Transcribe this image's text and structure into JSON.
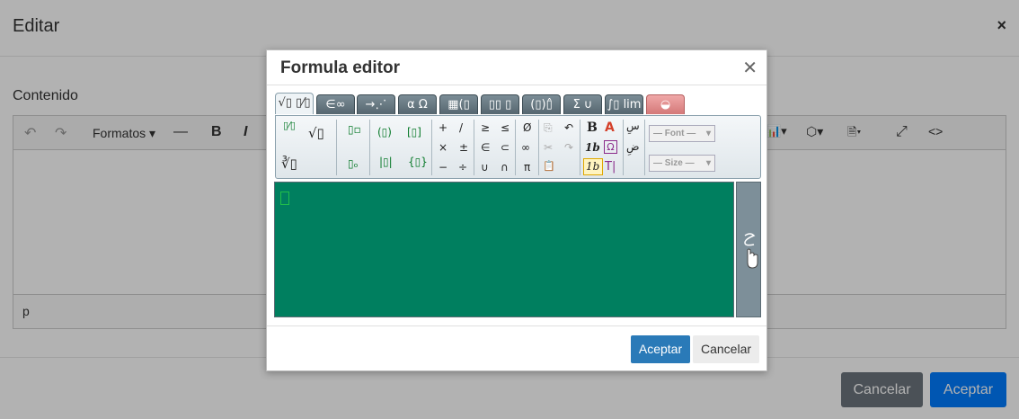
{
  "background": {
    "title": "Editar",
    "close_glyph": "×",
    "field_label": "Contenido",
    "toolbar": {
      "undo_glyph": "↶",
      "redo_glyph": "↷",
      "formats_label": "Formatos ▾",
      "hr_glyph": "—",
      "bold_glyph": "B",
      "italic_glyph": "I",
      "chart_glyph": "📊▾",
      "box_glyph": "⬡▾",
      "doc_glyph": "🗎▾",
      "fullscreen_glyph": "⤢",
      "code_glyph": "<>"
    },
    "status_path": "p",
    "cancel_label": "Cancelar",
    "accept_label": "Aceptar"
  },
  "modal": {
    "title": "Formula editor",
    "close_glyph": "✕",
    "tabs": [
      {
        "label": "√▯ ▯⁄▯",
        "icon": "fraction-root-tab"
      },
      {
        "label": "∈∞",
        "icon": "symbols-tab"
      },
      {
        "label": "→⋰",
        "icon": "arrows-tab"
      },
      {
        "label": "α Ω",
        "icon": "greek-tab"
      },
      {
        "label": "▦(▯",
        "icon": "matrix-tab"
      },
      {
        "label": "▯▯ ▯",
        "icon": "scripts-tab"
      },
      {
        "label": "(▯)▯̂",
        "icon": "brackets-tab"
      },
      {
        "label": "Σ ∪",
        "icon": "big-operators-tab"
      },
      {
        "label": "∫▯ lim",
        "icon": "calculus-tab"
      },
      {
        "label": "◒",
        "icon": "handwriting-tab"
      }
    ],
    "tools": {
      "fraction": "▯⁄▯",
      "sqrt": "√▯",
      "nroot": "∛▯",
      "superscript": "▯▫",
      "subscript": "▯ₒ",
      "parens": "(▯)",
      "brackets": "[▯]",
      "abs": "|▯|",
      "braces": "{▯}",
      "plus": "+",
      "slash": "/",
      "times": "×",
      "plusminus": "±",
      "minus": "−",
      "divide": "÷",
      "geq": "≥",
      "leq": "≤",
      "elem": "∈",
      "subset": "⊂",
      "union": "∪",
      "intersect": "∩",
      "emptyset": "Ø",
      "infinity": "∞",
      "pi": "π",
      "copy": "⎘",
      "cut": "✂",
      "paste": "📋",
      "undo": "↶",
      "redo": "↷",
      "bold": "B",
      "italic_b": "1b",
      "italic_b_sel": "1b",
      "color": "A",
      "omega_box": "Ω",
      "text_tool": "T|",
      "rtl": "سِ",
      "rtl2": "ضِ",
      "font_select": "— Font —",
      "size_select": "— Size —"
    },
    "accept_label": "Aceptar",
    "cancel_label": "Cancelar"
  },
  "colors": {
    "canvas": "#007f5f",
    "accept": "#2a7ab8",
    "bg_accept": "#007bff",
    "bg_cancel": "#6c757d"
  }
}
